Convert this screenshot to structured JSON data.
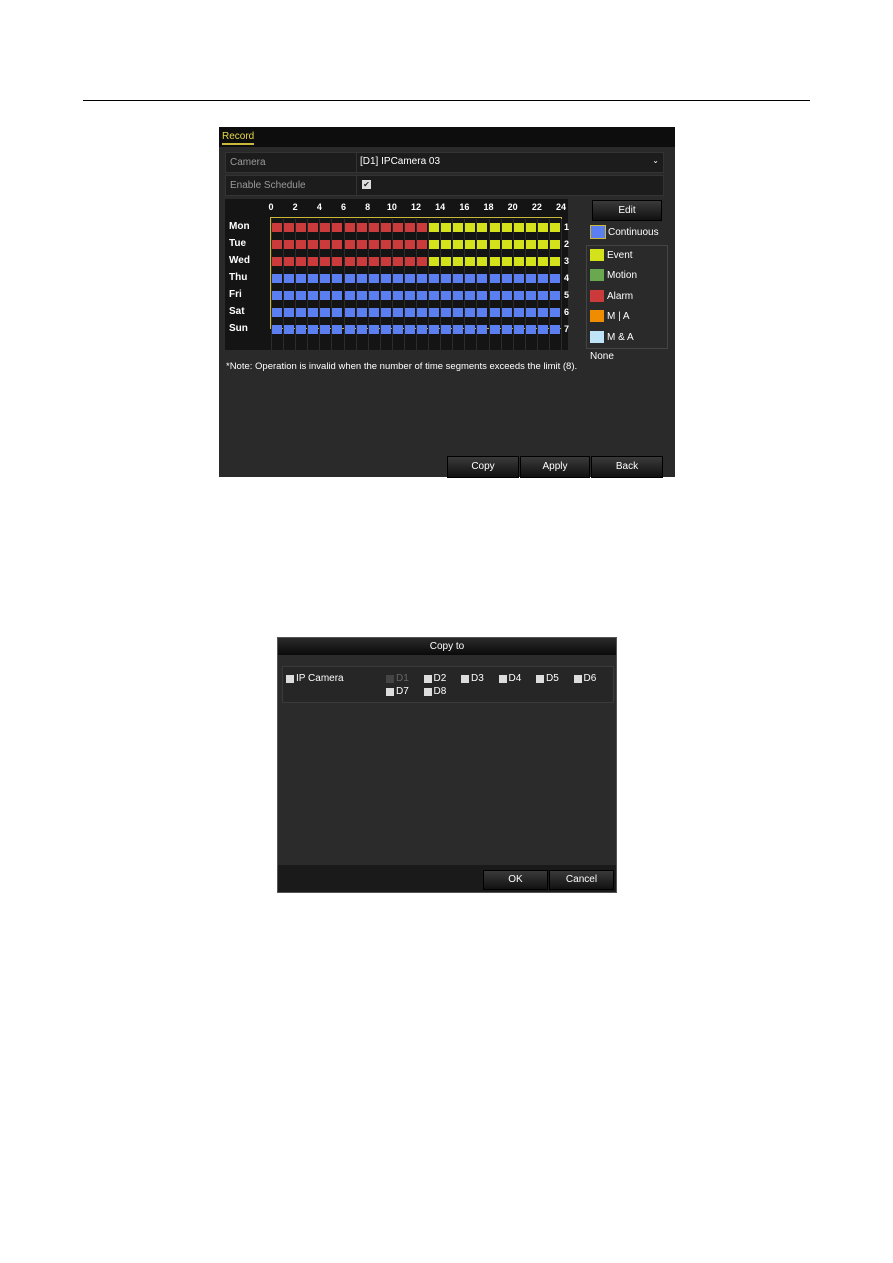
{
  "record": {
    "tab": "Record",
    "camera_label": "Camera",
    "camera_value": "[D1] IPCamera 03",
    "enable_label": "Enable Schedule",
    "enable_checked": true,
    "hours": [
      "0",
      "2",
      "4",
      "6",
      "8",
      "10",
      "12",
      "14",
      "16",
      "18",
      "20",
      "22",
      "24"
    ],
    "days": [
      {
        "day": "Mon",
        "num": "1",
        "segments": [
          {
            "type": "Alarm",
            "start": 0,
            "end": 13
          },
          {
            "type": "Event",
            "start": 13,
            "end": 24
          }
        ]
      },
      {
        "day": "Tue",
        "num": "2",
        "segments": [
          {
            "type": "Alarm",
            "start": 0,
            "end": 13
          },
          {
            "type": "Event",
            "start": 13,
            "end": 24
          }
        ]
      },
      {
        "day": "Wed",
        "num": "3",
        "segments": [
          {
            "type": "Alarm",
            "start": 0,
            "end": 13
          },
          {
            "type": "Event",
            "start": 13,
            "end": 24
          }
        ]
      },
      {
        "day": "Thu",
        "num": "4",
        "segments": [
          {
            "type": "Continuous",
            "start": 0,
            "end": 24
          }
        ]
      },
      {
        "day": "Fri",
        "num": "5",
        "segments": [
          {
            "type": "Continuous",
            "start": 0,
            "end": 24
          }
        ]
      },
      {
        "day": "Sat",
        "num": "6",
        "segments": [
          {
            "type": "Continuous",
            "start": 0,
            "end": 24
          }
        ]
      },
      {
        "day": "Sun",
        "num": "7",
        "segments": [
          {
            "type": "Continuous",
            "start": 0,
            "end": 24
          }
        ]
      }
    ],
    "edit": "Edit",
    "legend": [
      {
        "label": "Continuous",
        "color": "#5b7ff0"
      },
      {
        "label": "Event",
        "color": "#d4e21c"
      },
      {
        "label": "Motion",
        "color": "#6aa84f"
      },
      {
        "label": "Alarm",
        "color": "#cc3b3b"
      },
      {
        "label": "M | A",
        "color": "#f08c00"
      },
      {
        "label": "M & A",
        "color": "#bfe4f7"
      },
      {
        "label": "None",
        "color": ""
      }
    ],
    "note": "*Note: Operation is invalid when the number of time segments exceeds the limit (8).",
    "buttons": [
      "Copy",
      "Apply",
      "Back"
    ]
  },
  "copy": {
    "title": "Copy to",
    "group": "IP Camera",
    "cameras": [
      "D1",
      "D2",
      "D3",
      "D4",
      "D5",
      "D6",
      "D7",
      "D8"
    ],
    "ok": "OK",
    "cancel": "Cancel"
  }
}
